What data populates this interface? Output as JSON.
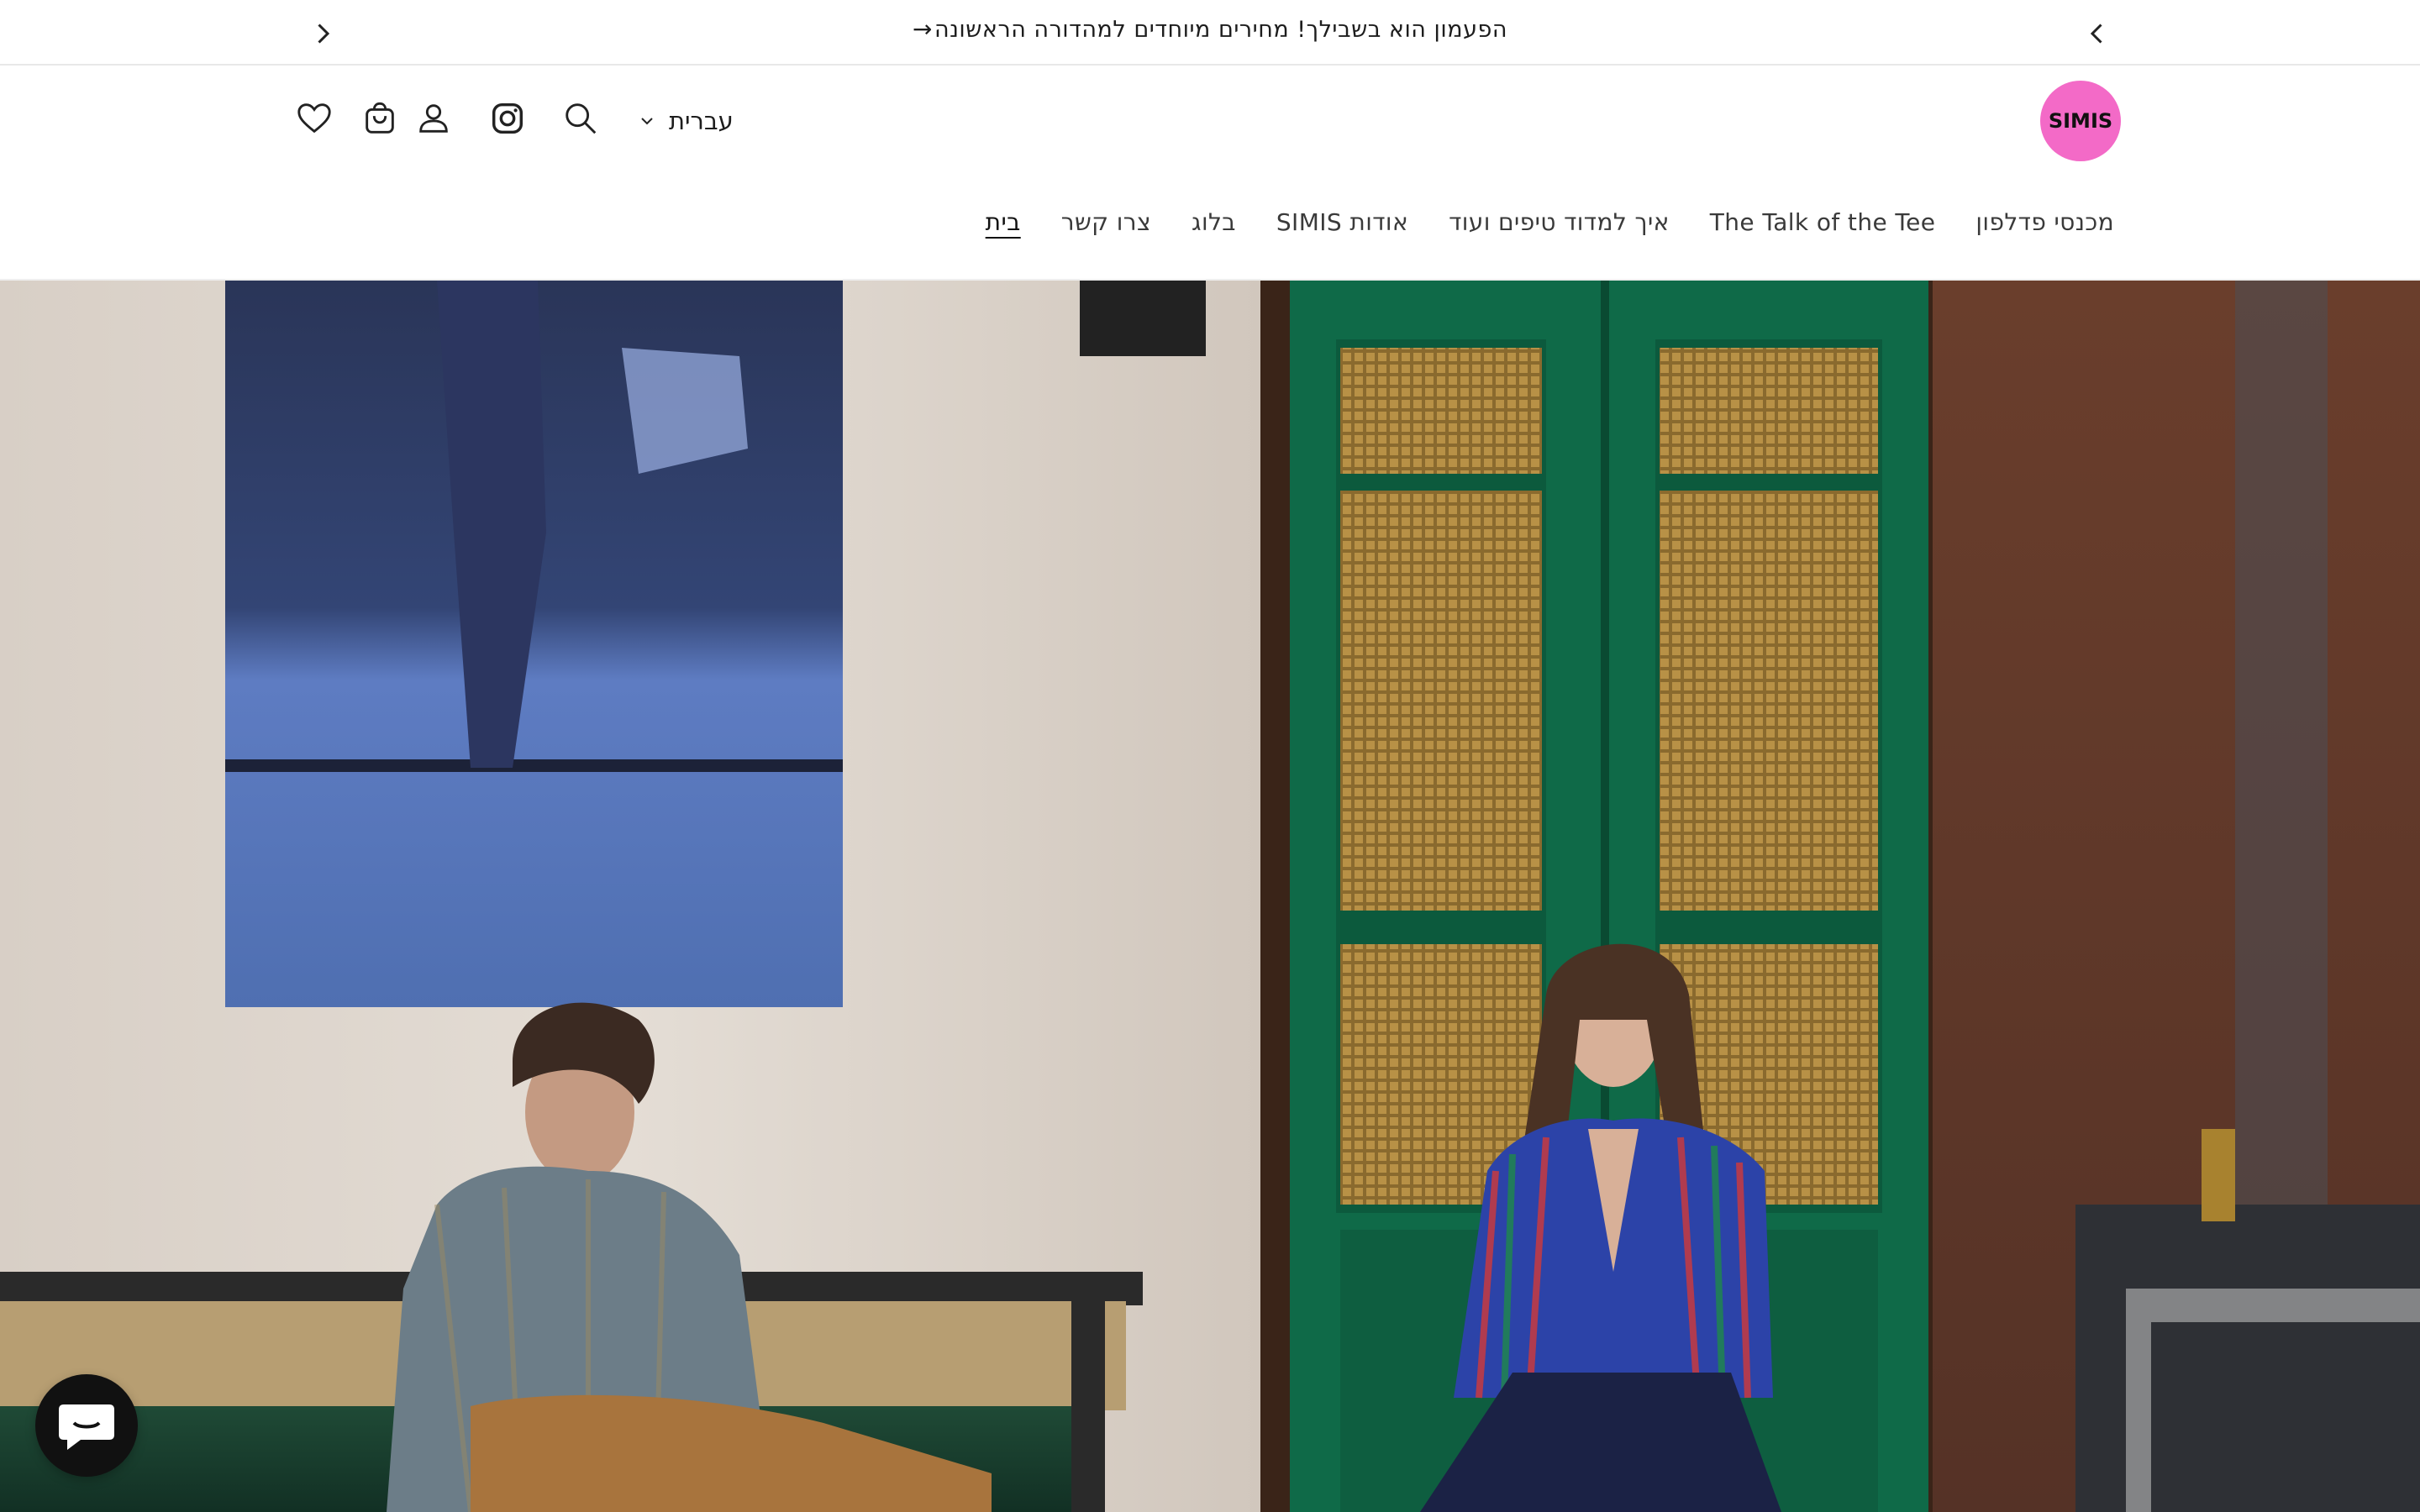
{
  "announcement": {
    "text": "הפעמון הוא בשבילך! מחירים מיוחדים למהדורה הראשונה",
    "arrow": "→"
  },
  "header": {
    "logo_text": "SIMIS",
    "logo_color": "#f36ac7",
    "language_label": "עברית",
    "icons": [
      "chevron-down-icon",
      "search-icon",
      "instagram-icon",
      "account-icon",
      "cart-icon",
      "wishlist-heart-icon"
    ]
  },
  "nav": {
    "items": [
      {
        "label": "בית",
        "active": true
      },
      {
        "label": "צרו קשר"
      },
      {
        "label": "בלוג"
      },
      {
        "label": "אודות SIMIS"
      },
      {
        "label": "איך למדוד טיפים ועוד"
      },
      {
        "label": "The Talk of the Tee"
      },
      {
        "label": "מכנסי פדלפון"
      }
    ]
  },
  "chat": {
    "icon": "chat-icon",
    "color": "#111111"
  }
}
